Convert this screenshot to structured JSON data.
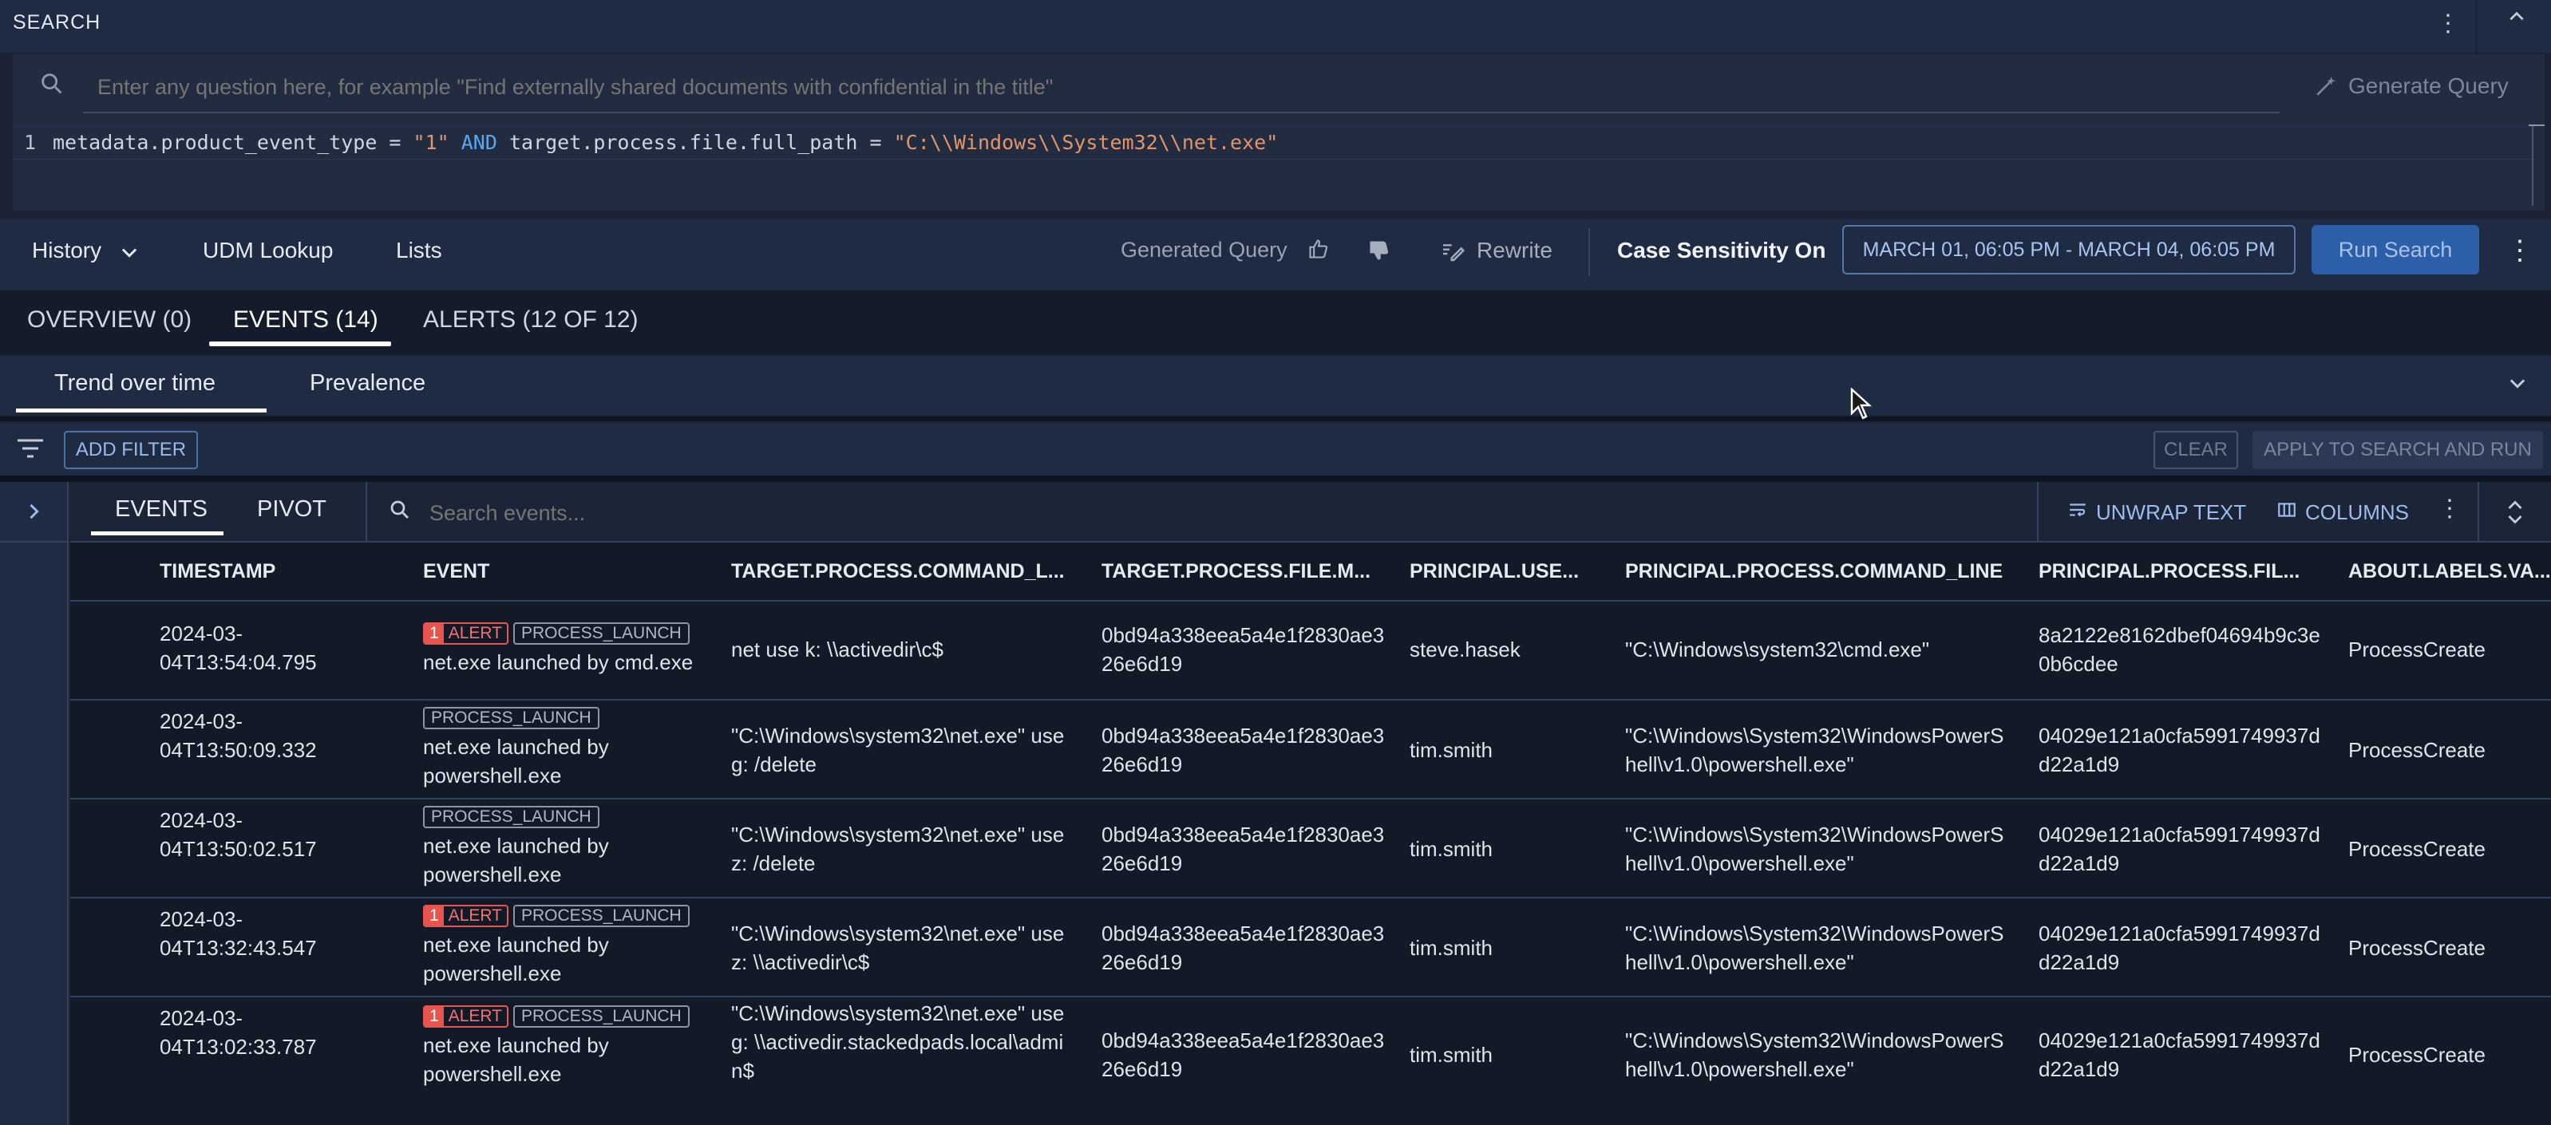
{
  "search_panel": {
    "title": "SEARCH",
    "ask_placeholder": "Enter any question here, for example \"Find externally shared documents with confidential in the title\"",
    "generate_query_label": "Generate Query",
    "line_number": "1",
    "query_parts": {
      "field1": "metadata.product_event_type = ",
      "value1": "\"1\"",
      "op": " AND ",
      "field2": "target.process.file.full_path = ",
      "value2": "\"C:\\\\Windows\\\\System32\\\\net.exe\""
    }
  },
  "toolbar": {
    "history_label": "History",
    "udm_lookup_label": "UDM Lookup",
    "lists_label": "Lists",
    "generated_query_label": "Generated Query",
    "rewrite_label": "Rewrite",
    "case_sensitivity_label": "Case Sensitivity On",
    "date_range": "MARCH 01, 06:05 PM - MARCH 04, 06:05 PM",
    "run_search_label": "Run Search"
  },
  "tabs": [
    "OVERVIEW (0)",
    "EVENTS (14)",
    "ALERTS (12 OF 12)"
  ],
  "trend": {
    "tab1": "Trend over time",
    "tab2": "Prevalence"
  },
  "filter_bar": {
    "add_filter": "ADD FILTER",
    "clear": "CLEAR",
    "apply": "APPLY TO SEARCH AND RUN"
  },
  "events_panel": {
    "tab_events": "EVENTS",
    "tab_pivot": "PIVOT",
    "search_placeholder": "Search events...",
    "unwrap_text": "UNWRAP TEXT",
    "columns": "COLUMNS"
  },
  "table": {
    "headers": [
      "TIMESTAMP",
      "EVENT",
      "TARGET.PROCESS.COMMAND_L...",
      "TARGET.PROCESS.FILE.M...",
      "PRINCIPAL.USE...",
      "PRINCIPAL.PROCESS.COMMAND_LINE",
      "PRINCIPAL.PROCESS.FIL...",
      "ABOUT.LABELS.VA..."
    ],
    "rows": [
      {
        "timestamp": "2024-03-04T13:54:04.795",
        "alert_count": "1",
        "alert_label": "ALERT",
        "event_type": "PROCESS_LAUNCH",
        "event_text": "net.exe launched by cmd.exe",
        "target_cmd": "net use k: \\\\activedir\\c$",
        "target_hash": "0bd94a338eea5a4e1f2830ae326e6d19",
        "user": "steve.hasek",
        "principal_cmd": "\"C:\\Windows\\system32\\cmd.exe\"",
        "principal_file": "8a2122e8162dbef04694b9c3e0b6cdee",
        "about": "ProcessCreate"
      },
      {
        "timestamp": "2024-03-04T13:50:09.332",
        "alert_count": "",
        "alert_label": "",
        "event_type": "PROCESS_LAUNCH",
        "event_text": "net.exe launched by powershell.exe",
        "target_cmd": "\"C:\\Windows\\system32\\net.exe\" use g: /delete",
        "target_hash": "0bd94a338eea5a4e1f2830ae326e6d19",
        "user": "tim.smith",
        "principal_cmd": "\"C:\\Windows\\System32\\WindowsPowerShell\\v1.0\\powershell.exe\"",
        "principal_file": "04029e121a0cfa5991749937dd22a1d9",
        "about": "ProcessCreate"
      },
      {
        "timestamp": "2024-03-04T13:50:02.517",
        "alert_count": "",
        "alert_label": "",
        "event_type": "PROCESS_LAUNCH",
        "event_text": "net.exe launched by powershell.exe",
        "target_cmd": "\"C:\\Windows\\system32\\net.exe\" use z: /delete",
        "target_hash": "0bd94a338eea5a4e1f2830ae326e6d19",
        "user": "tim.smith",
        "principal_cmd": "\"C:\\Windows\\System32\\WindowsPowerShell\\v1.0\\powershell.exe\"",
        "principal_file": "04029e121a0cfa5991749937dd22a1d9",
        "about": "ProcessCreate"
      },
      {
        "timestamp": "2024-03-04T13:32:43.547",
        "alert_count": "1",
        "alert_label": "ALERT",
        "event_type": "PROCESS_LAUNCH",
        "event_text": "net.exe launched by powershell.exe",
        "target_cmd": "\"C:\\Windows\\system32\\net.exe\" use z: \\\\activedir\\c$",
        "target_hash": "0bd94a338eea5a4e1f2830ae326e6d19",
        "user": "tim.smith",
        "principal_cmd": "\"C:\\Windows\\System32\\WindowsPowerShell\\v1.0\\powershell.exe\"",
        "principal_file": "04029e121a0cfa5991749937dd22a1d9",
        "about": "ProcessCreate"
      },
      {
        "timestamp": "2024-03-04T13:02:33.787",
        "alert_count": "1",
        "alert_label": "ALERT",
        "event_type": "PROCESS_LAUNCH",
        "event_text": "net.exe launched by powershell.exe",
        "target_cmd": "\"C:\\Windows\\system32\\net.exe\" use g: \\\\activedir.stackedpads.local\\admin$",
        "target_hash": "0bd94a338eea5a4e1f2830ae326e6d19",
        "user": "tim.smith",
        "principal_cmd": "\"C:\\Windows\\System32\\WindowsPowerShell\\v1.0\\powershell.exe\"",
        "principal_file": "04029e121a0cfa5991749937dd22a1d9",
        "about": "ProcessCreate"
      }
    ]
  },
  "colors": {
    "accent": "#2d5fa8",
    "alert": "#e8554e",
    "background": "#1a2234"
  },
  "icons": [
    "search-icon",
    "generate-wand-icon",
    "chevron-down-icon",
    "thumbs-up-icon",
    "thumbs-down-icon",
    "rewrite-pencil-icon",
    "more-vert-icon",
    "chevron-up-icon",
    "filter-icon",
    "chevron-right-icon",
    "wrap-text-icon",
    "columns-icon",
    "expand-icon",
    "mouse-cursor-icon"
  ]
}
